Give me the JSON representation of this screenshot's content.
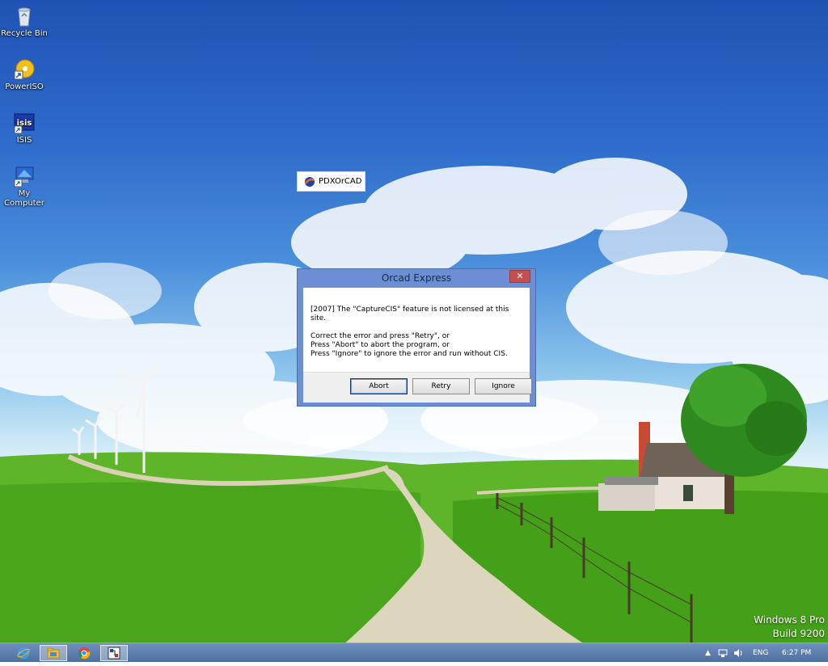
{
  "desktop": {
    "icons": [
      {
        "label": "Recycle Bin",
        "icon": "recycle-bin-icon"
      },
      {
        "label": "PowerISO",
        "icon": "poweriso-icon"
      },
      {
        "label": "ISIS",
        "icon": "isis-icon"
      },
      {
        "label": "My Computer",
        "icon": "my-computer-icon"
      }
    ],
    "floating_label": "PDXOrCAD"
  },
  "dialog": {
    "title": "Orcad Express",
    "close_glyph": "✕",
    "message_line1": "[2007] The \"CaptureCIS\" feature is not licensed at this site.",
    "message_line2": "Correct the error and press \"Retry\", or",
    "message_line3": "Press \"Abort\" to abort the program, or",
    "message_line4": "Press \"Ignore\" to ignore the error and run without CIS.",
    "buttons": {
      "abort": "Abort",
      "retry": "Retry",
      "ignore": "Ignore"
    }
  },
  "watermark": {
    "line1": "Windows 8 Pro",
    "line2": "Build 9200"
  },
  "taskbar": {
    "apps": [
      "internet-explorer-icon",
      "file-explorer-icon",
      "chrome-icon",
      "orcad-app-icon"
    ],
    "tray": {
      "chevron": "▲",
      "language": "ENG",
      "time": "6:27 PM"
    }
  },
  "colors": {
    "dialog_frame": "#6b8fd2",
    "close_button": "#c74e4e",
    "taskbar": "#5a7aaa"
  }
}
